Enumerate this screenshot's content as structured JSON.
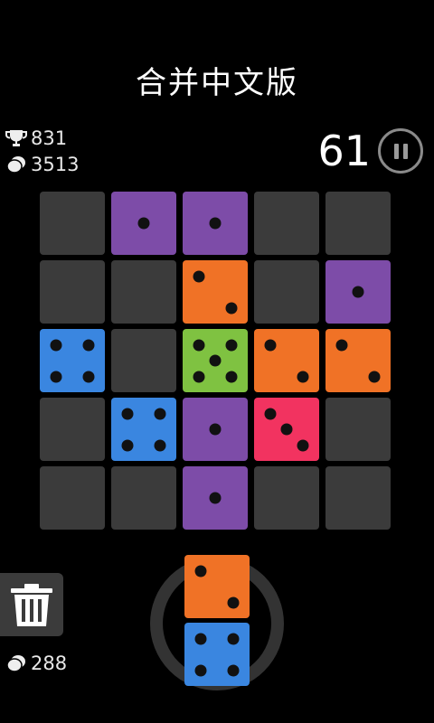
{
  "header": {
    "title": "合并中文版"
  },
  "stats": {
    "best_score": "831",
    "coins": "3513",
    "bottom_coins": "288"
  },
  "score": "61",
  "icons": {
    "trophy": "trophy-icon",
    "coin": "coin-icon",
    "pause": "pause-icon",
    "trash": "trash-icon"
  },
  "colors": {
    "empty": "#3b3b3b",
    "purple": "#7d4ca8",
    "orange": "#f07226",
    "green": "#7fc241",
    "blue": "#3a86e0",
    "red": "#f23360"
  },
  "board": [
    [
      {
        "color": "empty",
        "pips": 0
      },
      {
        "color": "purple",
        "pips": 1
      },
      {
        "color": "purple",
        "pips": 1
      },
      {
        "color": "empty",
        "pips": 0
      },
      {
        "color": "empty",
        "pips": 0
      }
    ],
    [
      {
        "color": "empty",
        "pips": 0
      },
      {
        "color": "empty",
        "pips": 0
      },
      {
        "color": "orange",
        "pips": 2
      },
      {
        "color": "empty",
        "pips": 0
      },
      {
        "color": "purple",
        "pips": 1
      }
    ],
    [
      {
        "color": "blue",
        "pips": 4
      },
      {
        "color": "empty",
        "pips": 0
      },
      {
        "color": "green",
        "pips": 5
      },
      {
        "color": "orange",
        "pips": 2
      },
      {
        "color": "orange",
        "pips": 2
      }
    ],
    [
      {
        "color": "empty",
        "pips": 0
      },
      {
        "color": "blue",
        "pips": 4
      },
      {
        "color": "purple",
        "pips": 1
      },
      {
        "color": "red",
        "pips": 3
      },
      {
        "color": "empty",
        "pips": 0
      }
    ],
    [
      {
        "color": "empty",
        "pips": 0
      },
      {
        "color": "empty",
        "pips": 0
      },
      {
        "color": "purple",
        "pips": 1
      },
      {
        "color": "empty",
        "pips": 0
      },
      {
        "color": "empty",
        "pips": 0
      }
    ]
  ],
  "next_piece": [
    {
      "color": "orange",
      "pips": 2
    },
    {
      "color": "blue",
      "pips": 4
    }
  ]
}
